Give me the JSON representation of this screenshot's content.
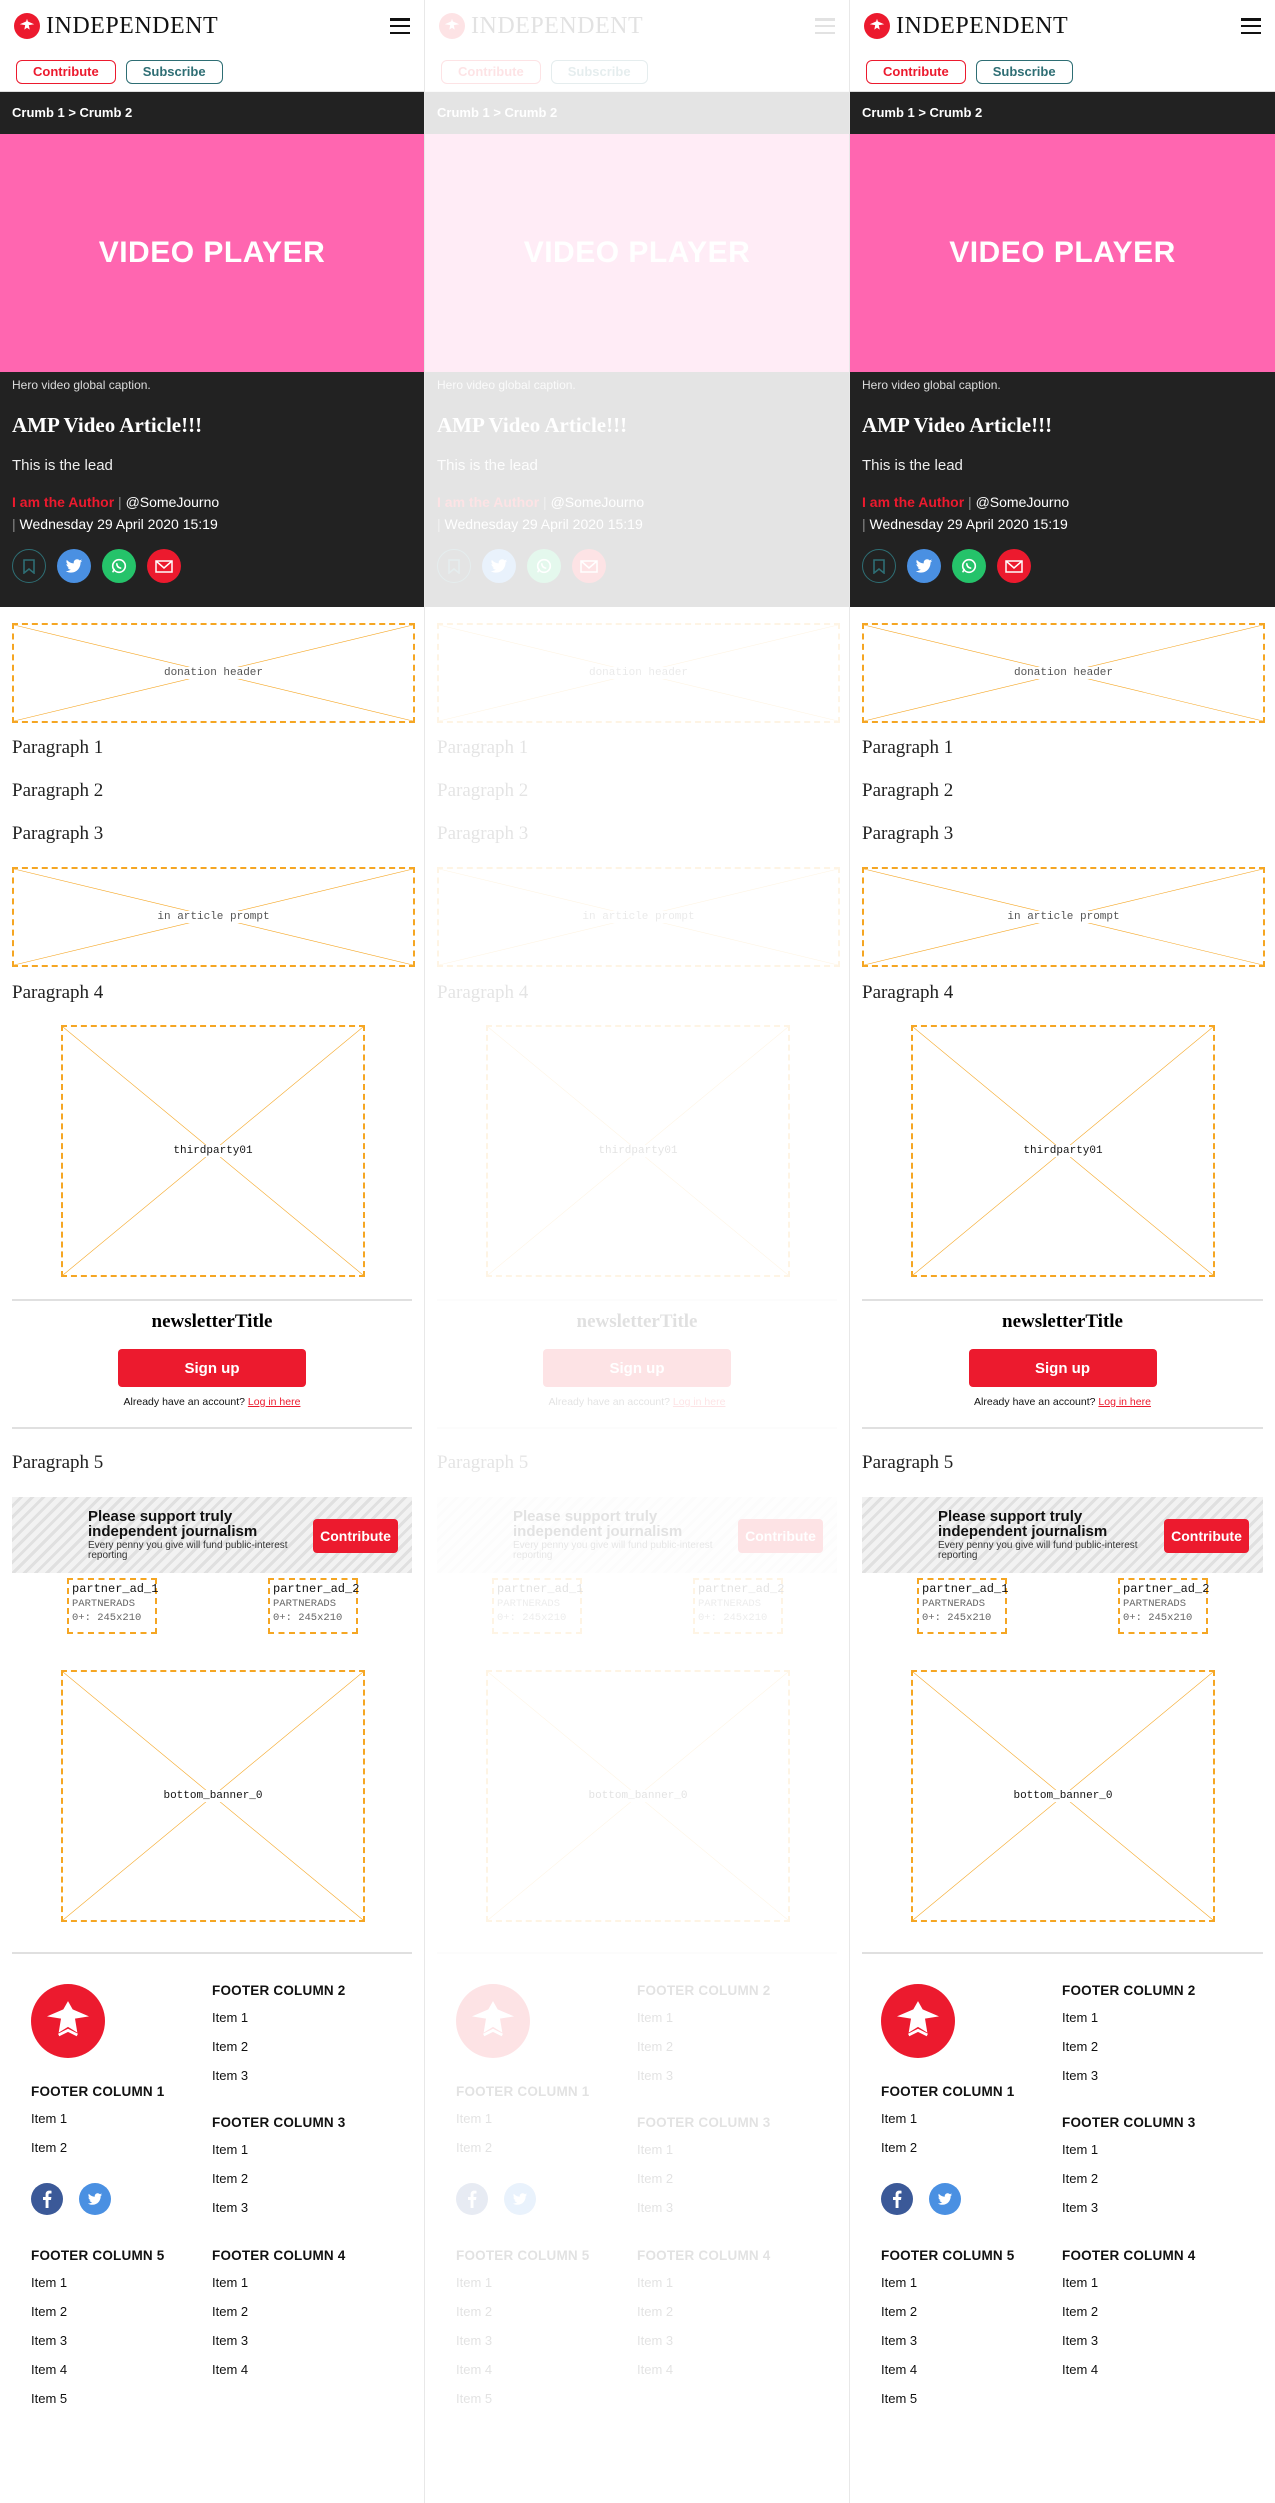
{
  "header": {
    "brand": "INDEPENDENT",
    "contribute_label": "Contribute",
    "subscribe_label": "Subscribe"
  },
  "breadcrumb": {
    "text": "Crumb 1 > Crumb 2"
  },
  "video": {
    "label": "VIDEO PLAYER",
    "caption": "Hero video global caption."
  },
  "article": {
    "title": "AMP Video Article!!!",
    "lead": "This is the lead",
    "author": "I am the Author",
    "handle": "@SomeJourno",
    "date": "Wednesday 29 April 2020 15:19",
    "paragraphs": [
      "Paragraph 1",
      "Paragraph 2",
      "Paragraph 3",
      "Paragraph 4",
      "Paragraph 5"
    ]
  },
  "placeholders": {
    "donation_header": "donation header",
    "in_article_prompt": "in article prompt",
    "thirdparty": "thirdparty01",
    "bottom_banner": "bottom_banner_0"
  },
  "newsletter": {
    "title": "newsletterTitle",
    "signup_label": "Sign up",
    "already_text": "Already have an account?",
    "login_label": "Log in here"
  },
  "support": {
    "headline": "Please support truly independent journalism",
    "subtext": "Every penny you give will fund public-interest reporting",
    "button_label": "Contribute"
  },
  "partner_ads": [
    {
      "name": "partner_ad_1",
      "network": "PARTNERADS",
      "size": "0+: 245x210"
    },
    {
      "name": "partner_ad_2",
      "network": "PARTNERADS",
      "size": "0+: 245x210"
    }
  ],
  "footer": {
    "col1": {
      "title": "FOOTER COLUMN 1",
      "items": [
        "Item 1",
        "Item 2"
      ]
    },
    "col2": {
      "title": "FOOTER COLUMN 2",
      "items": [
        "Item 1",
        "Item 2",
        "Item 3"
      ]
    },
    "col3": {
      "title": "FOOTER COLUMN 3",
      "items": [
        "Item 1",
        "Item 2",
        "Item 3"
      ]
    },
    "col4": {
      "title": "FOOTER COLUMN 4",
      "items": [
        "Item 1",
        "Item 2",
        "Item 3",
        "Item 4"
      ]
    },
    "col5": {
      "title": "FOOTER COLUMN 5",
      "items": [
        "Item 1",
        "Item 2",
        "Item 3",
        "Item 4",
        "Item 5"
      ]
    }
  },
  "colors": {
    "brand_red": "#ec1a2e",
    "video_pink": "#ff66b0",
    "dark_bg": "#222222",
    "placeholder_orange": "#f5a623",
    "teal": "#2e6e74"
  },
  "icons": {
    "logo": "eagle-logo-icon",
    "menu": "hamburger-menu-icon",
    "share": [
      "bookmark-icon",
      "twitter-icon",
      "whatsapp-icon",
      "email-icon"
    ],
    "footer_social": [
      "facebook-icon",
      "twitter-icon"
    ]
  }
}
